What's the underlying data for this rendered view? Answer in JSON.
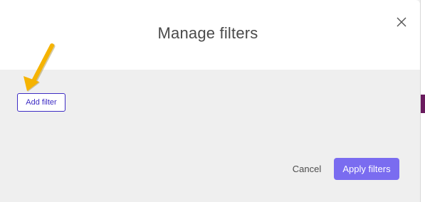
{
  "dialog": {
    "title": "Manage filters",
    "add_filter_label": "Add filter",
    "cancel_label": "Cancel",
    "apply_label": "Apply filters"
  },
  "icons": {
    "close": "close-icon",
    "arrow": "arrow-annotation-icon"
  },
  "colors": {
    "accent": "#3d2cc4",
    "apply_button": "#7a6cf0",
    "annotation_arrow": "#f5b301",
    "body_background": "#efefef"
  }
}
